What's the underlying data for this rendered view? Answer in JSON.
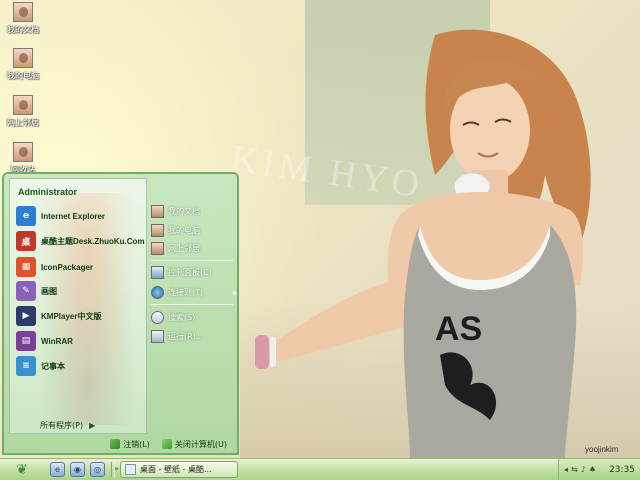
{
  "desktop": {
    "icons": [
      {
        "label": "我的文档"
      },
      {
        "label": "我的电脑"
      },
      {
        "label": "网上邻居"
      },
      {
        "label": "回收站"
      }
    ],
    "watermark": "KIM HYO",
    "signature": "yoojinkim"
  },
  "start_menu": {
    "user": "Administrator",
    "programs": [
      {
        "label": "Internet Explorer",
        "icon": "ie-icon",
        "color": "#2d7fd3"
      },
      {
        "label": "桌酷主题Desk.ZhuoKu.Com",
        "icon": "zhuoku-icon",
        "color": "#c0382b"
      },
      {
        "label": "IconPackager",
        "icon": "iconpackager-icon",
        "color": "#e0532a"
      },
      {
        "label": "画图",
        "icon": "paint-icon",
        "color": "#8a62b8"
      },
      {
        "label": "KMPlayer中文版",
        "icon": "kmplayer-icon",
        "color": "#2b3b6a"
      },
      {
        "label": "WinRAR",
        "icon": "winrar-icon",
        "color": "#7a3f9a"
      },
      {
        "label": "记事本",
        "icon": "notepad-icon",
        "color": "#3a8fd0"
      }
    ],
    "all_programs": "所有程序(P)",
    "right_items": [
      {
        "label": "我的文档"
      },
      {
        "label": "我的电脑"
      },
      {
        "label": "网上邻居"
      }
    ],
    "system_items": [
      {
        "label": "控制面板(C)"
      },
      {
        "label": "连接到(T)"
      },
      {
        "label": "搜索(S)"
      },
      {
        "label": "运行(R)..."
      }
    ],
    "logoff": "注销(L)",
    "shutdown": "关闭计算机(U)"
  },
  "taskbar": {
    "task_button": "桌面 - 壁纸 - 桌酷...",
    "clock": "23:35"
  },
  "colors": {
    "accent": "#6fae6a",
    "taskbar": "#a9d38a"
  }
}
